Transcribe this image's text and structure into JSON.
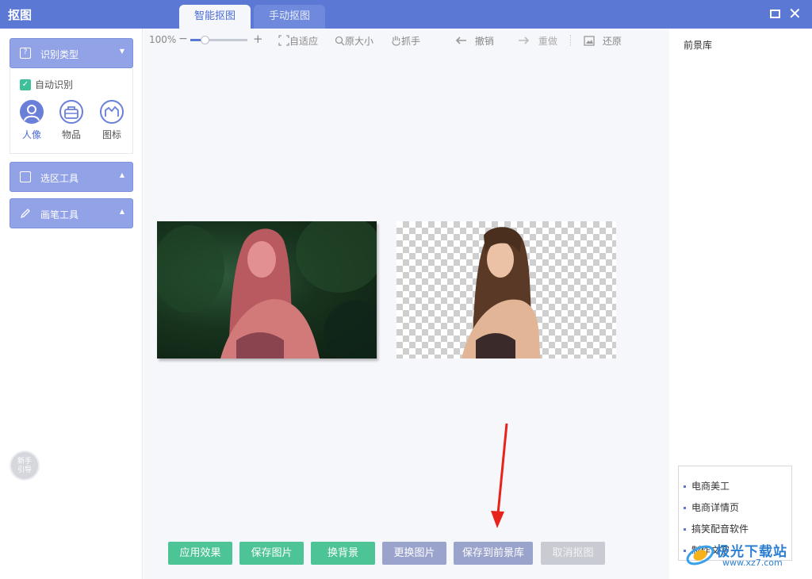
{
  "app": {
    "title": "抠图"
  },
  "tabs": [
    {
      "label": "智能抠图",
      "active": true
    },
    {
      "label": "手动抠图",
      "active": false
    }
  ],
  "window": {
    "maximize_icon": "maximize-icon",
    "close_glyph": "✕"
  },
  "sidebar": {
    "recognize": {
      "label": "识别类型",
      "auto_label": "自动识别",
      "auto_checked": true,
      "types": [
        {
          "label": "人像",
          "icon": "person-icon",
          "selected": true
        },
        {
          "label": "物品",
          "icon": "bag-icon",
          "selected": false
        },
        {
          "label": "图标",
          "icon": "shape-icon",
          "selected": false
        }
      ]
    },
    "select_tool": {
      "label": "选区工具"
    },
    "brush_tool": {
      "label": "画笔工具"
    },
    "guide": {
      "line1": "新手",
      "line2": "引导"
    }
  },
  "toolbar": {
    "zoom_value": "100%",
    "zoom_minus": "−",
    "zoom_plus": "+",
    "zoom_level": 0.25,
    "fit": "自适应",
    "original_size": "原大小",
    "grab": "抓手",
    "undo": "撤销",
    "redo": "重做",
    "restore": "还原"
  },
  "buttons": {
    "apply": "应用效果",
    "save": "保存图片",
    "change_bg": "换背景",
    "replace_image": "更换图片",
    "save_to_library": "保存到前景库",
    "cancel": "取消抠图"
  },
  "right_panel": {
    "title": "前景库",
    "links": [
      "电商美工",
      "电商详情页",
      "搞笑配音软件",
      "制作文字"
    ]
  },
  "watermark": {
    "text": "极光下载站",
    "url": "www.xz7.com"
  },
  "colors": {
    "accent": "#5b78d4",
    "green": "#4cc496",
    "panel": "#92a2e6",
    "arrow": "#e8231c"
  }
}
